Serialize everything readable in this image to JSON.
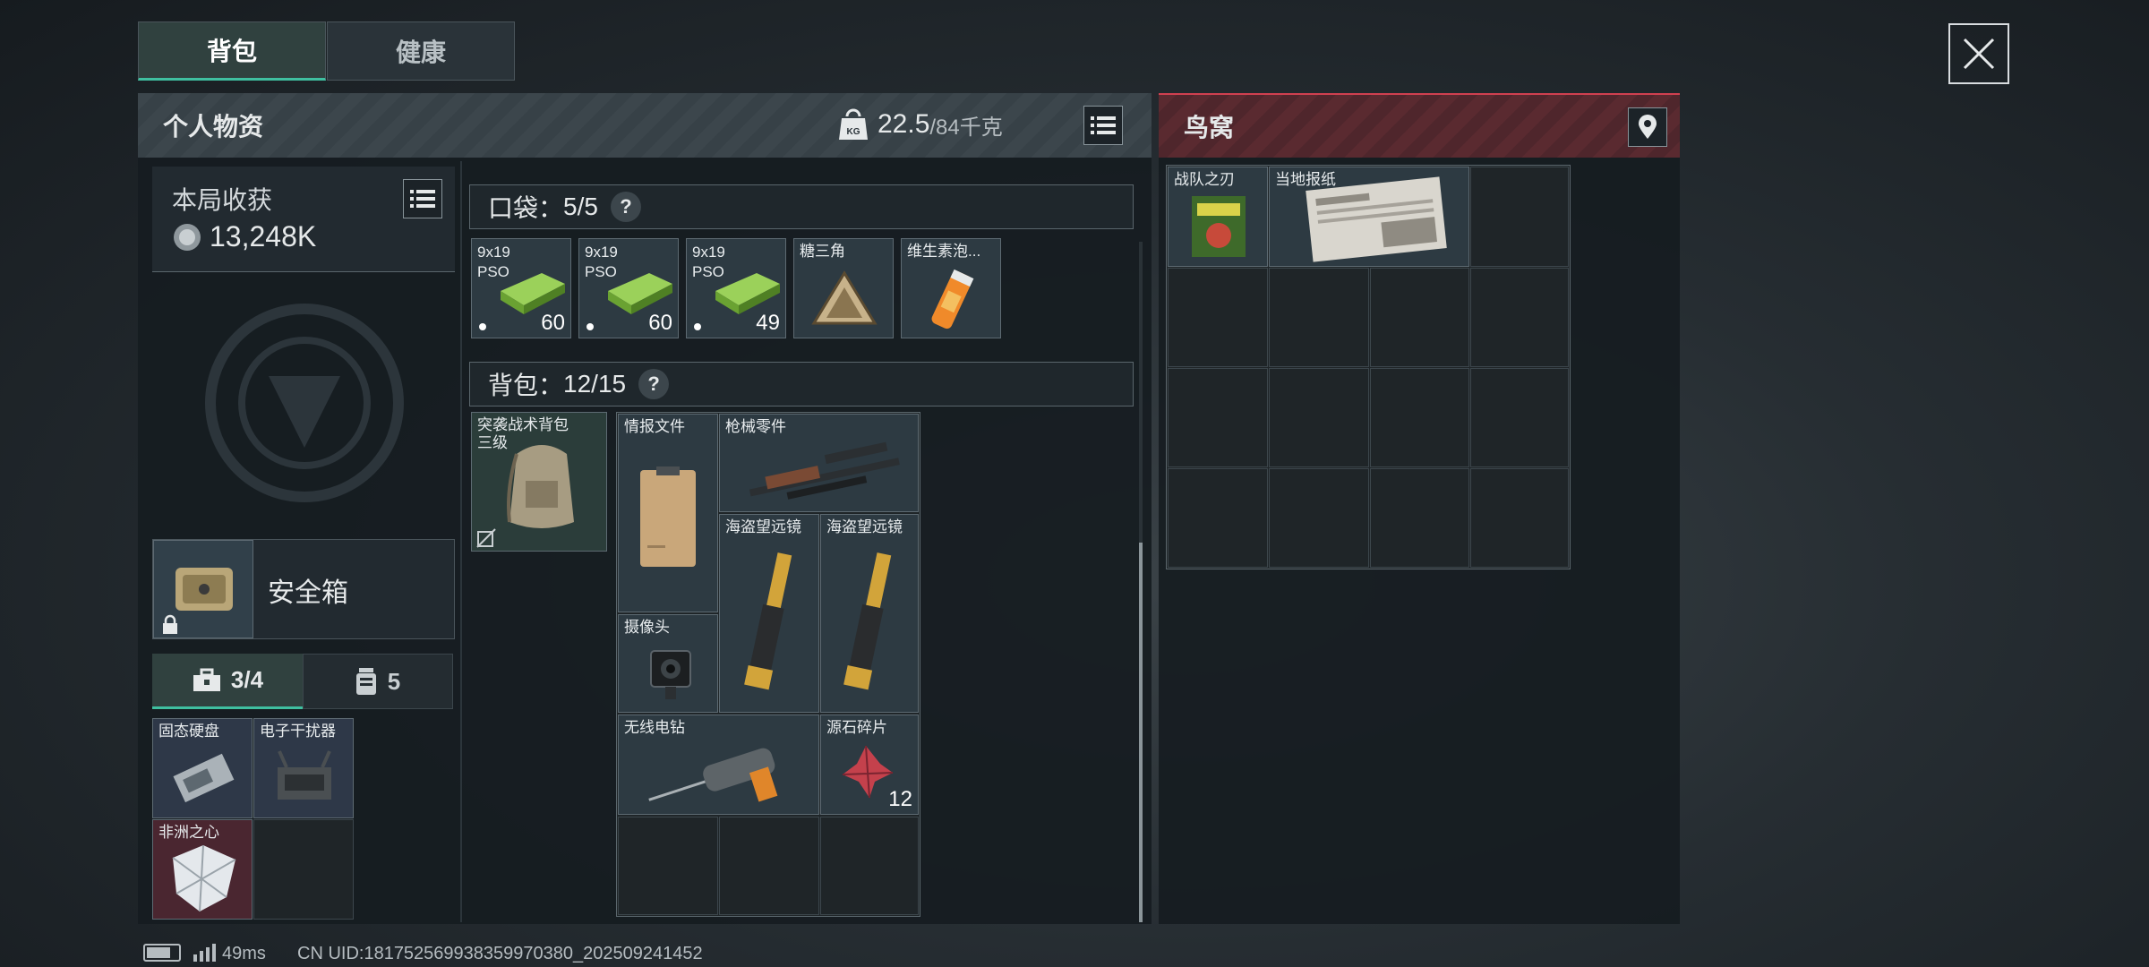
{
  "tabs": [
    {
      "label": "背包"
    },
    {
      "label": "健康"
    }
  ],
  "left_header": {
    "title": "个人物资",
    "weight_current": "22.5",
    "weight_max": "/84千克"
  },
  "harvest": {
    "label": "本局收获",
    "value": "13,248K"
  },
  "safebox": {
    "label": "安全箱"
  },
  "sub_tabs": [
    {
      "label": "3/4"
    },
    {
      "label": "5"
    }
  ],
  "safebox_items": [
    {
      "name": "固态硬盘"
    },
    {
      "name": "电子干扰器"
    },
    {
      "name": "非洲之心"
    }
  ],
  "pocket": {
    "label": "口袋：",
    "count": "5/5",
    "help": "?"
  },
  "pocket_items": [
    {
      "name": "9x19\nPSO",
      "count": "60"
    },
    {
      "name": "9x19\nPSO",
      "count": "60"
    },
    {
      "name": "9x19\nPSO",
      "count": "49"
    },
    {
      "name": "糖三角",
      "count": ""
    },
    {
      "name": "维生素泡...",
      "count": ""
    }
  ],
  "backpack": {
    "label": "背包：",
    "count": "12/15",
    "help": "?",
    "equipped_name": "突袭战术背包\n三级"
  },
  "backpack_items": [
    {
      "name": "情报文件"
    },
    {
      "name": "枪械零件"
    },
    {
      "name": "海盗望远镜"
    },
    {
      "name": "海盗望远镜"
    },
    {
      "name": "摄像头"
    },
    {
      "name": "无线电钻"
    },
    {
      "name": "源石碎片",
      "count": "12"
    }
  ],
  "right_header": {
    "title": "鸟窝"
  },
  "loot_items": [
    {
      "name": "战队之刃"
    },
    {
      "name": "当地报纸"
    }
  ],
  "statusbar": {
    "ping": "49ms",
    "uid": "CN UID:181752569938359970380_202509241452"
  },
  "colors": {
    "accent": "#3fbfa0",
    "red_header": "#d04050",
    "slot_blue": "#2d3a42",
    "slot_red": "#4a2630"
  }
}
